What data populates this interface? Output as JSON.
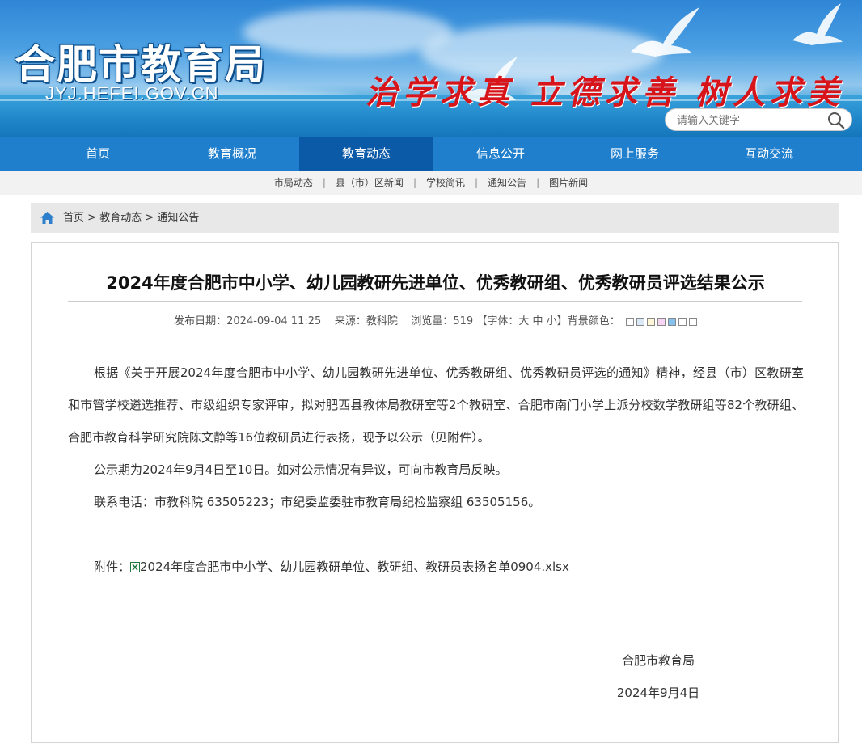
{
  "header": {
    "logo": "合肥市教育局",
    "domain": "JYJ.HEFEI.GOV.CN",
    "motto": "治学求真 立德求善 树人求美",
    "search_placeholder": "请输入关键字"
  },
  "nav": {
    "items": [
      {
        "label": "首页"
      },
      {
        "label": "教育概况"
      },
      {
        "label": "教育动态"
      },
      {
        "label": "信息公开"
      },
      {
        "label": "网上服务"
      },
      {
        "label": "互动交流"
      }
    ],
    "active_index": 2
  },
  "subnav": {
    "items": [
      "市局动态",
      "县（市）区新闻",
      "学校简讯",
      "通知公告",
      "图片新闻"
    ]
  },
  "breadcrumb": {
    "items": [
      "首页",
      "教育动态",
      "通知公告"
    ],
    "separator": ">"
  },
  "article": {
    "title": "2024年度合肥市中小学、幼儿园教研先进单位、优秀教研组、优秀教研员评选结果公示",
    "meta": {
      "date_label": "发布日期：",
      "date": "2024-09-04 11:25",
      "source_label": "来源：",
      "source": "教科院",
      "views_label": "浏览量：",
      "views": "519",
      "font_prefix": "【字体：",
      "font_large": "大",
      "font_medium": "中",
      "font_small": "小",
      "font_suffix": "】",
      "bg_label": "背景颜色：",
      "bg_colors": [
        "#ffffff",
        "#dbe9f6",
        "#fdf7d8",
        "#f7d6f5",
        "#87c1ee",
        "#ffffff",
        "#ffffff"
      ]
    },
    "paragraphs": [
      "根据《关于开展2024年度合肥市中小学、幼儿园教研先进单位、优秀教研组、优秀教研员评选的通知》精神，经县（市）区教研室和市管学校遴选推荐、市级组织专家评审，拟对肥西县教体局教研室等2个教研室、合肥市南门小学上派分校数学教研组等82个教研组、合肥市教育科学研究院陈文静等16位教研员进行表扬，现予以公示（见附件）。",
      "公示期为2024年9月4日至10日。如对公示情况有异议，可向市教育局反映。",
      "联系电话：市教科院  63505223；市纪委监委驻市教育局纪检监察组  63505156。"
    ],
    "attachment_label": "附件：",
    "attachment_name": "2024年度合肥市中小学、幼儿园教研单位、教研组、教研员表扬名单0904.xlsx",
    "signature": "合肥市教育局",
    "sign_date": "2024年9月4日"
  }
}
